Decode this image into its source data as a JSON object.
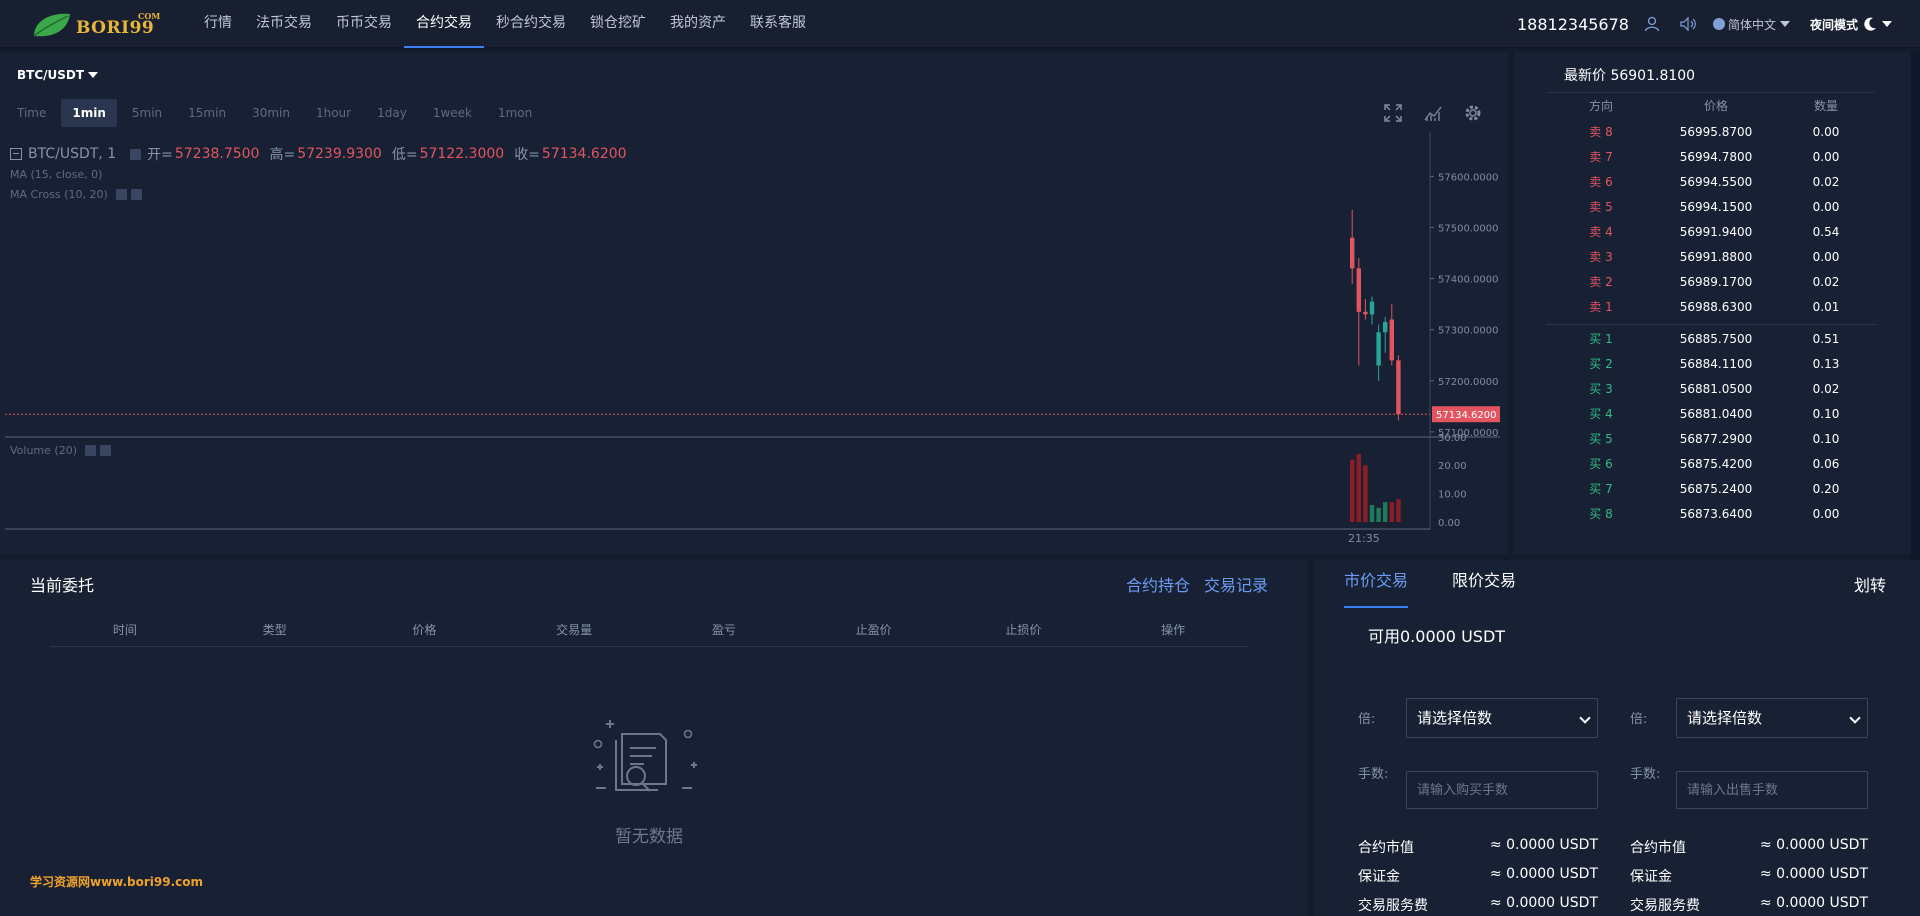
{
  "brand": {
    "name": "BORI99",
    "suffix": "COM"
  },
  "nav": {
    "items": [
      "行情",
      "法币交易",
      "币币交易",
      "合约交易",
      "秒合约交易",
      "锁仓挖矿",
      "我的资产",
      "联系客服"
    ],
    "active_index": 3,
    "phone": "18812345678",
    "language": "简体中文",
    "night_mode": "夜间模式",
    "icons": [
      "user-icon",
      "speaker-icon",
      "globe-icon",
      "moon-icon"
    ]
  },
  "chart": {
    "pair": "BTC/USDT",
    "timeframes": [
      "Time",
      "1min",
      "5min",
      "15min",
      "30min",
      "1hour",
      "1day",
      "1week",
      "1mon"
    ],
    "active_timeframe": "1min",
    "legend_symbol": "BTC/USDT, 1",
    "ohlc": {
      "open_label": "开=",
      "open": "57238.7500",
      "high_label": "高=",
      "high": "57239.9300",
      "low_label": "低=",
      "low": "57122.3000",
      "close_label": "收=",
      "close": "57134.6200"
    },
    "indicators": [
      "MA (15, close, 0)",
      "MA Cross (10, 20)"
    ],
    "volume_label": "Volume (20)",
    "time_label": "21:35",
    "current_price_tag": "57134.6200",
    "colors": {
      "up": "#26a69a",
      "down": "#e25560",
      "background": "#182133"
    }
  },
  "chart_data": {
    "type": "candlestick",
    "y_ticks": [
      "57600.0000",
      "57500.0000",
      "57400.0000",
      "57300.0000",
      "57200.0000",
      "57100.0000"
    ],
    "ylim": [
      57090,
      57640
    ],
    "volume_ticks": [
      "30.00",
      "20.00",
      "10.00",
      "0.00"
    ],
    "volume_ylim": [
      0,
      31
    ],
    "candles": [
      {
        "o": 57480,
        "h": 57535,
        "l": 57390,
        "c": 57420,
        "v": 22
      },
      {
        "o": 57420,
        "h": 57440,
        "l": 57230,
        "c": 57335,
        "v": 24
      },
      {
        "o": 57335,
        "h": 57360,
        "l": 57320,
        "c": 57330,
        "v": 20
      },
      {
        "o": 57330,
        "h": 57365,
        "l": 57310,
        "c": 57355,
        "v": 6
      },
      {
        "o": 57230,
        "h": 57310,
        "l": 57200,
        "c": 57295,
        "v": 5
      },
      {
        "o": 57295,
        "h": 57325,
        "l": 57255,
        "c": 57315,
        "v": 7
      },
      {
        "o": 57320,
        "h": 57350,
        "l": 57230,
        "c": 57240,
        "v": 7
      },
      {
        "o": 57240,
        "h": 57250,
        "l": 57122.3,
        "c": 57134.62,
        "v": 8
      }
    ],
    "last_price": 57134.62
  },
  "book": {
    "latest_label": "最新价",
    "latest_price": "56901.8100",
    "headers": [
      "方向",
      "价格",
      "数量"
    ],
    "asks": [
      {
        "side": "卖 8",
        "price": "56995.8700",
        "qty": "0.00"
      },
      {
        "side": "卖 7",
        "price": "56994.7800",
        "qty": "0.00"
      },
      {
        "side": "卖 6",
        "price": "56994.5500",
        "qty": "0.02"
      },
      {
        "side": "卖 5",
        "price": "56994.1500",
        "qty": "0.00"
      },
      {
        "side": "卖 4",
        "price": "56991.9400",
        "qty": "0.54"
      },
      {
        "side": "卖 3",
        "price": "56991.8800",
        "qty": "0.00"
      },
      {
        "side": "卖 2",
        "price": "56989.1700",
        "qty": "0.02"
      },
      {
        "side": "卖 1",
        "price": "56988.6300",
        "qty": "0.01"
      }
    ],
    "bids": [
      {
        "side": "买 1",
        "price": "56885.7500",
        "qty": "0.51"
      },
      {
        "side": "买 2",
        "price": "56884.1100",
        "qty": "0.13"
      },
      {
        "side": "买 3",
        "price": "56881.0500",
        "qty": "0.02"
      },
      {
        "side": "买 4",
        "price": "56881.0400",
        "qty": "0.10"
      },
      {
        "side": "买 5",
        "price": "56877.2900",
        "qty": "0.10"
      },
      {
        "side": "买 6",
        "price": "56875.4200",
        "qty": "0.06"
      },
      {
        "side": "买 7",
        "price": "56875.2400",
        "qty": "0.20"
      },
      {
        "side": "买 8",
        "price": "56873.6400",
        "qty": "0.00"
      }
    ]
  },
  "orders": {
    "title": "当前委托",
    "links": [
      "合约持仓",
      "交易记录"
    ],
    "headers": [
      "时间",
      "类型",
      "价格",
      "交易量",
      "盈亏",
      "止盈价",
      "止损价",
      "操作"
    ],
    "empty_text": "暂无数据",
    "watermark": "学习资源网www.bori99.com"
  },
  "trade": {
    "tabs": [
      "市价交易",
      "限价交易"
    ],
    "transfer": "划转",
    "available": "可用0.0000 USDT",
    "buy": {
      "multiplier_label": "倍:",
      "multiplier_value": "请选择倍数",
      "lots_label": "手数:",
      "lots_placeholder": "请输入购买手数"
    },
    "sell": {
      "multiplier_label": "倍:",
      "multiplier_value": "请选择倍数",
      "lots_label": "手数:",
      "lots_placeholder": "请输入出售手数"
    },
    "stats": [
      {
        "label": "合约市值",
        "value": "≈ 0.0000 USDT"
      },
      {
        "label": "保证金",
        "value": "≈ 0.0000 USDT"
      },
      {
        "label": "交易服务费",
        "value": "≈ 0.0000 USDT"
      }
    ]
  }
}
